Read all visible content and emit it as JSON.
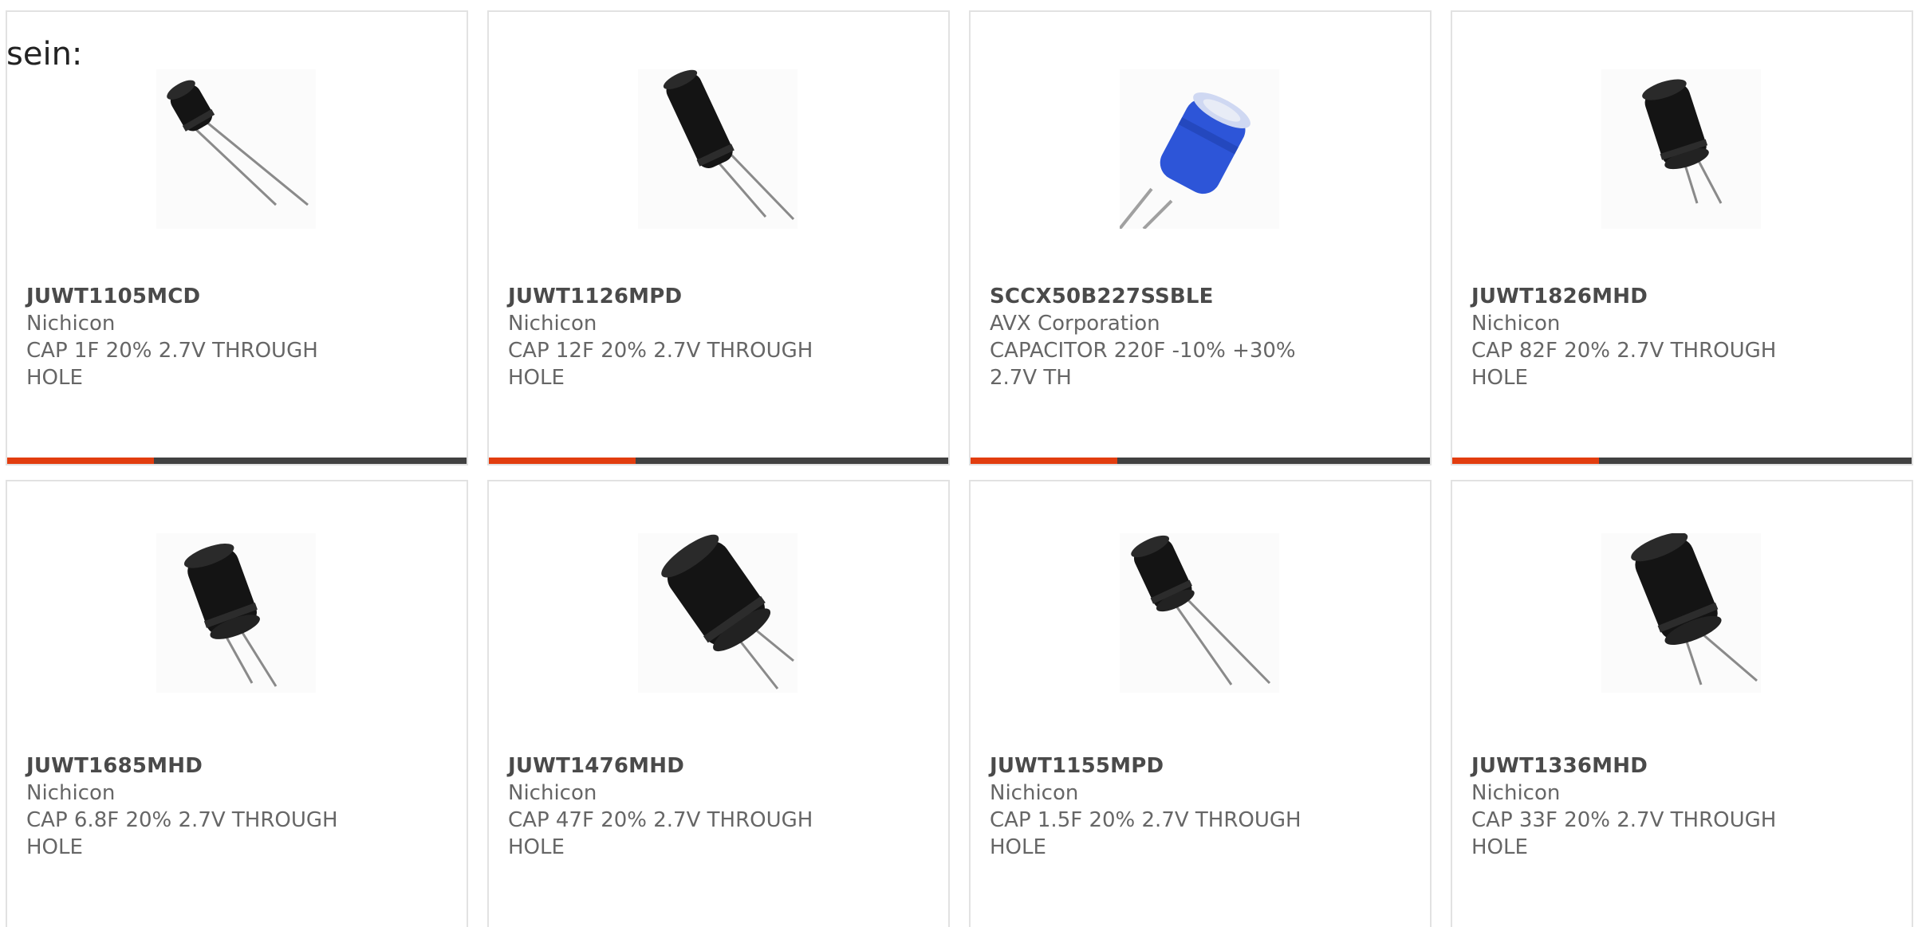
{
  "intro_text": "sein:",
  "colors": {
    "accent": "#e23d0f",
    "bar_track": "#414141",
    "card_border": "#e2e2e2",
    "capacitor_black": "#141414",
    "capacitor_blue": "#2d55d8"
  },
  "products": [
    {
      "part_number": "JUWT1105MCD",
      "manufacturer": "Nichicon",
      "description_line1": "CAP 1F 20% 2.7V THROUGH",
      "description_line2": "HOLE",
      "image_icon": "black-radial-capacitor-small-icon",
      "progress": 0.32
    },
    {
      "part_number": "JUWT1126MPD",
      "manufacturer": "Nichicon",
      "description_line1": "CAP 12F 20% 2.7V THROUGH",
      "description_line2": "HOLE",
      "image_icon": "black-radial-capacitor-long-icon",
      "progress": 0.32
    },
    {
      "part_number": "SCCX50B227SSBLE",
      "manufacturer": "AVX Corporation",
      "description_line1": "CAPACITOR 220F -10% +30%",
      "description_line2": "2.7V TH",
      "image_icon": "blue-radial-capacitor-icon",
      "progress": 0.32
    },
    {
      "part_number": "JUWT1826MHD",
      "manufacturer": "Nichicon",
      "description_line1": "CAP 82F 20% 2.7V THROUGH",
      "description_line2": "HOLE",
      "image_icon": "black-radial-capacitor-icon",
      "progress": 0.32
    },
    {
      "part_number": "JUWT1685MHD",
      "manufacturer": "Nichicon",
      "description_line1": "CAP 6.8F 20% 2.7V THROUGH",
      "description_line2": "HOLE",
      "image_icon": "black-radial-capacitor-icon"
    },
    {
      "part_number": "JUWT1476MHD",
      "manufacturer": "Nichicon",
      "description_line1": "CAP 47F 20% 2.7V THROUGH",
      "description_line2": "HOLE",
      "image_icon": "black-radial-capacitor-large-icon"
    },
    {
      "part_number": "JUWT1155MPD",
      "manufacturer": "Nichicon",
      "description_line1": "CAP 1.5F 20% 2.7V THROUGH",
      "description_line2": "HOLE",
      "image_icon": "black-radial-capacitor-icon"
    },
    {
      "part_number": "JUWT1336MHD",
      "manufacturer": "Nichicon",
      "description_line1": "CAP 33F 20% 2.7V THROUGH",
      "description_line2": "HOLE",
      "image_icon": "black-radial-capacitor-icon"
    }
  ]
}
